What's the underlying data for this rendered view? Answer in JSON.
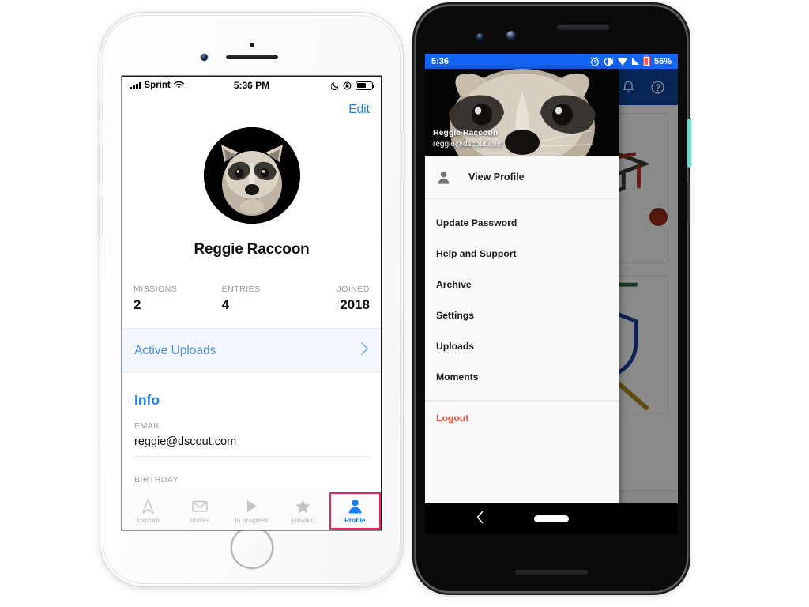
{
  "ios": {
    "status_bar": {
      "carrier": "Sprint",
      "time": "5:36 PM",
      "signal_icon": "cellular-signal-icon",
      "wifi_icon": "wifi-icon",
      "moon_icon": "do-not-disturb-icon",
      "lock_icon": "rotation-lock-icon",
      "battery_icon": "battery-icon"
    },
    "edit_label": "Edit",
    "avatar_name": "raccoon-avatar",
    "profile_name": "Reggie Raccoon",
    "stats": [
      {
        "label": "MISSIONS",
        "value": "2"
      },
      {
        "label": "ENTRIES",
        "value": "4"
      },
      {
        "label": "JOINED",
        "value": "2018"
      }
    ],
    "active_uploads": {
      "label": "Active Uploads",
      "chevron": "›"
    },
    "info": {
      "heading": "Info",
      "fields": [
        {
          "label": "EMAIL",
          "value": "reggie@dscout.com"
        },
        {
          "label": "BIRTHDAY",
          "value": ""
        }
      ]
    },
    "tabs": [
      {
        "label": "Explore",
        "icon": "navigation-arrow-icon",
        "active": false
      },
      {
        "label": "Invites",
        "icon": "envelope-icon",
        "active": false
      },
      {
        "label": "In progress",
        "icon": "play-triangle-icon",
        "active": false
      },
      {
        "label": "Reward",
        "icon": "star-icon",
        "active": false
      },
      {
        "label": "Profile",
        "icon": "person-icon",
        "active": true
      }
    ],
    "highlight_color": "#e8265a",
    "accent_color": "#1b81f2"
  },
  "android": {
    "status_bar": {
      "time": "5:36",
      "battery_text": "56%",
      "alarm_icon": "alarm-clock-icon",
      "vibrate_icon": "vibrate-icon",
      "wifi_icon": "wifi-icon",
      "signal_icon": "cellular-signal-icon",
      "battery_icon": "battery-icon"
    },
    "appbar": {
      "notification_icon": "bell-icon",
      "help_icon": "help-circle-icon",
      "color": "#0d47a1"
    },
    "drawer": {
      "header_name": "Reggie Raccoon",
      "header_email": "reggie@dscout.com",
      "view_profile": {
        "label": "View Profile",
        "icon": "person-icon"
      },
      "items": [
        {
          "label": "Update Password"
        },
        {
          "label": "Help and Support"
        },
        {
          "label": "Archive"
        },
        {
          "label": "Settings"
        },
        {
          "label": "Uploads"
        },
        {
          "label": "Moments"
        }
      ],
      "logout": {
        "label": "Logout",
        "color": "#e8503a"
      }
    },
    "background_icons": [
      "graduation-cap-icon",
      "shield-lock-icon",
      "house-icon",
      "star-icon"
    ],
    "nav": {
      "back_icon": "back-chevron-icon",
      "home_pill": "home-pill-indicator"
    }
  }
}
